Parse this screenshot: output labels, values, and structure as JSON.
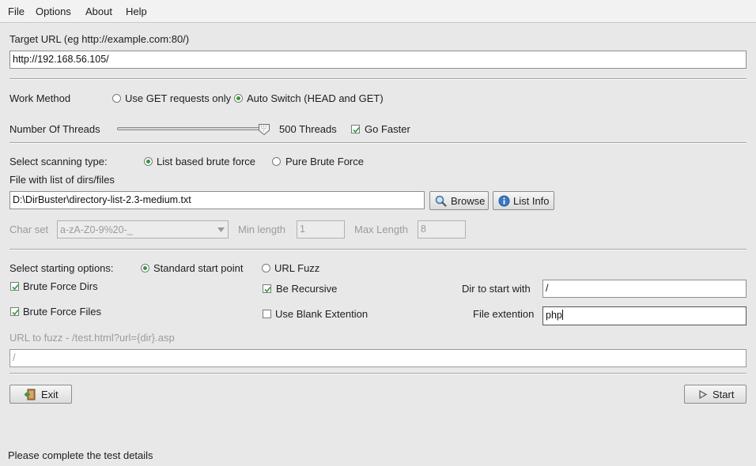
{
  "menu": {
    "file": "File",
    "options": "Options",
    "about": "About",
    "help": "Help"
  },
  "target": {
    "label": "Target URL (eg http://example.com:80/)",
    "value": "http://192.168.56.105/"
  },
  "work_method": {
    "label": "Work Method",
    "get_only": "Use GET requests only",
    "auto_switch": "Auto Switch (HEAD and GET)",
    "selected": "auto_switch"
  },
  "threads": {
    "label": "Number Of Threads",
    "value_text": "500 Threads",
    "slider_fraction": 1.0,
    "go_faster": "Go Faster",
    "go_faster_checked": true
  },
  "scan": {
    "label": "Select scanning type:",
    "list_based": "List based brute force",
    "pure": "Pure Brute Force",
    "selected": "list_based"
  },
  "file_list": {
    "label": "File with list of dirs/files",
    "value": "D:\\DirBuster\\directory-list-2.3-medium.txt",
    "browse": "Browse",
    "list_info": "List Info"
  },
  "charset": {
    "label": "Char set",
    "value": "a-zA-Z0-9%20-_",
    "min_label": "Min length",
    "min_value": "1",
    "max_label": "Max Length",
    "max_value": "8"
  },
  "start_opts": {
    "label": "Select starting options:",
    "standard": "Standard start point",
    "url_fuzz": "URL Fuzz",
    "selected": "standard",
    "brute_dirs": "Brute Force Dirs",
    "brute_dirs_checked": true,
    "brute_files": "Brute Force Files",
    "brute_files_checked": true,
    "recursive": "Be Recursive",
    "recursive_checked": true,
    "blank_ext": "Use Blank Extention",
    "blank_ext_checked": false,
    "dir_label": "Dir to start with",
    "dir_value": "/",
    "ext_label": "File extention",
    "ext_value": "php"
  },
  "fuzz": {
    "label": "URL to fuzz - /test.html?url={dir}.asp",
    "value": "/"
  },
  "buttons": {
    "exit": "Exit",
    "start": "Start"
  },
  "status": "Please complete the test details",
  "colors": {
    "radio_selected": "#2f9a3a",
    "background": "#e8e8e8"
  }
}
